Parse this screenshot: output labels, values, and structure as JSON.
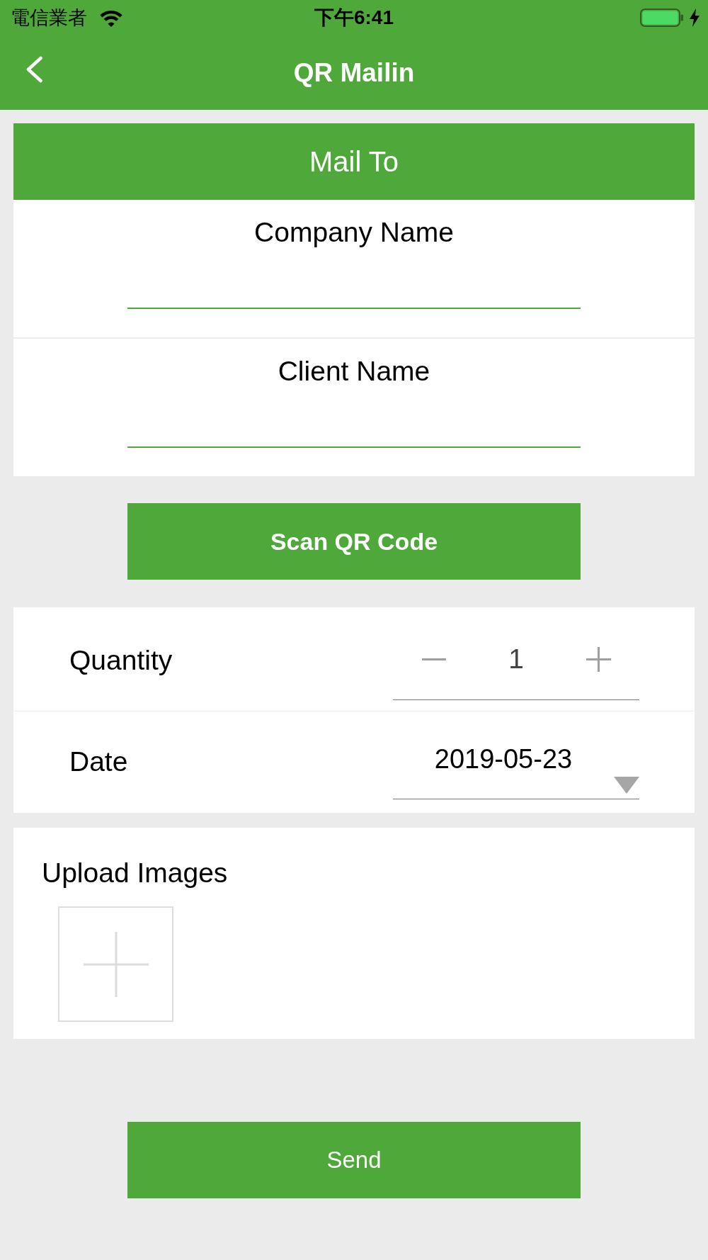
{
  "status_bar": {
    "carrier": "電信業者",
    "time": "下午6:41"
  },
  "nav_bar": {
    "title": "QR Mailin"
  },
  "mail_to": {
    "header": "Mail To",
    "fields": [
      {
        "label": "Company Name"
      },
      {
        "label": "Client Name"
      }
    ]
  },
  "scan_button": {
    "label": "Scan QR Code"
  },
  "details": {
    "rows": [
      {
        "kind": "stepper",
        "label": "Quantity",
        "value": "1"
      },
      {
        "kind": "date",
        "label": "Date",
        "value": "2019-05-23"
      }
    ]
  },
  "upload": {
    "label": "Upload Images"
  },
  "send_button": {
    "label": "Send"
  }
}
